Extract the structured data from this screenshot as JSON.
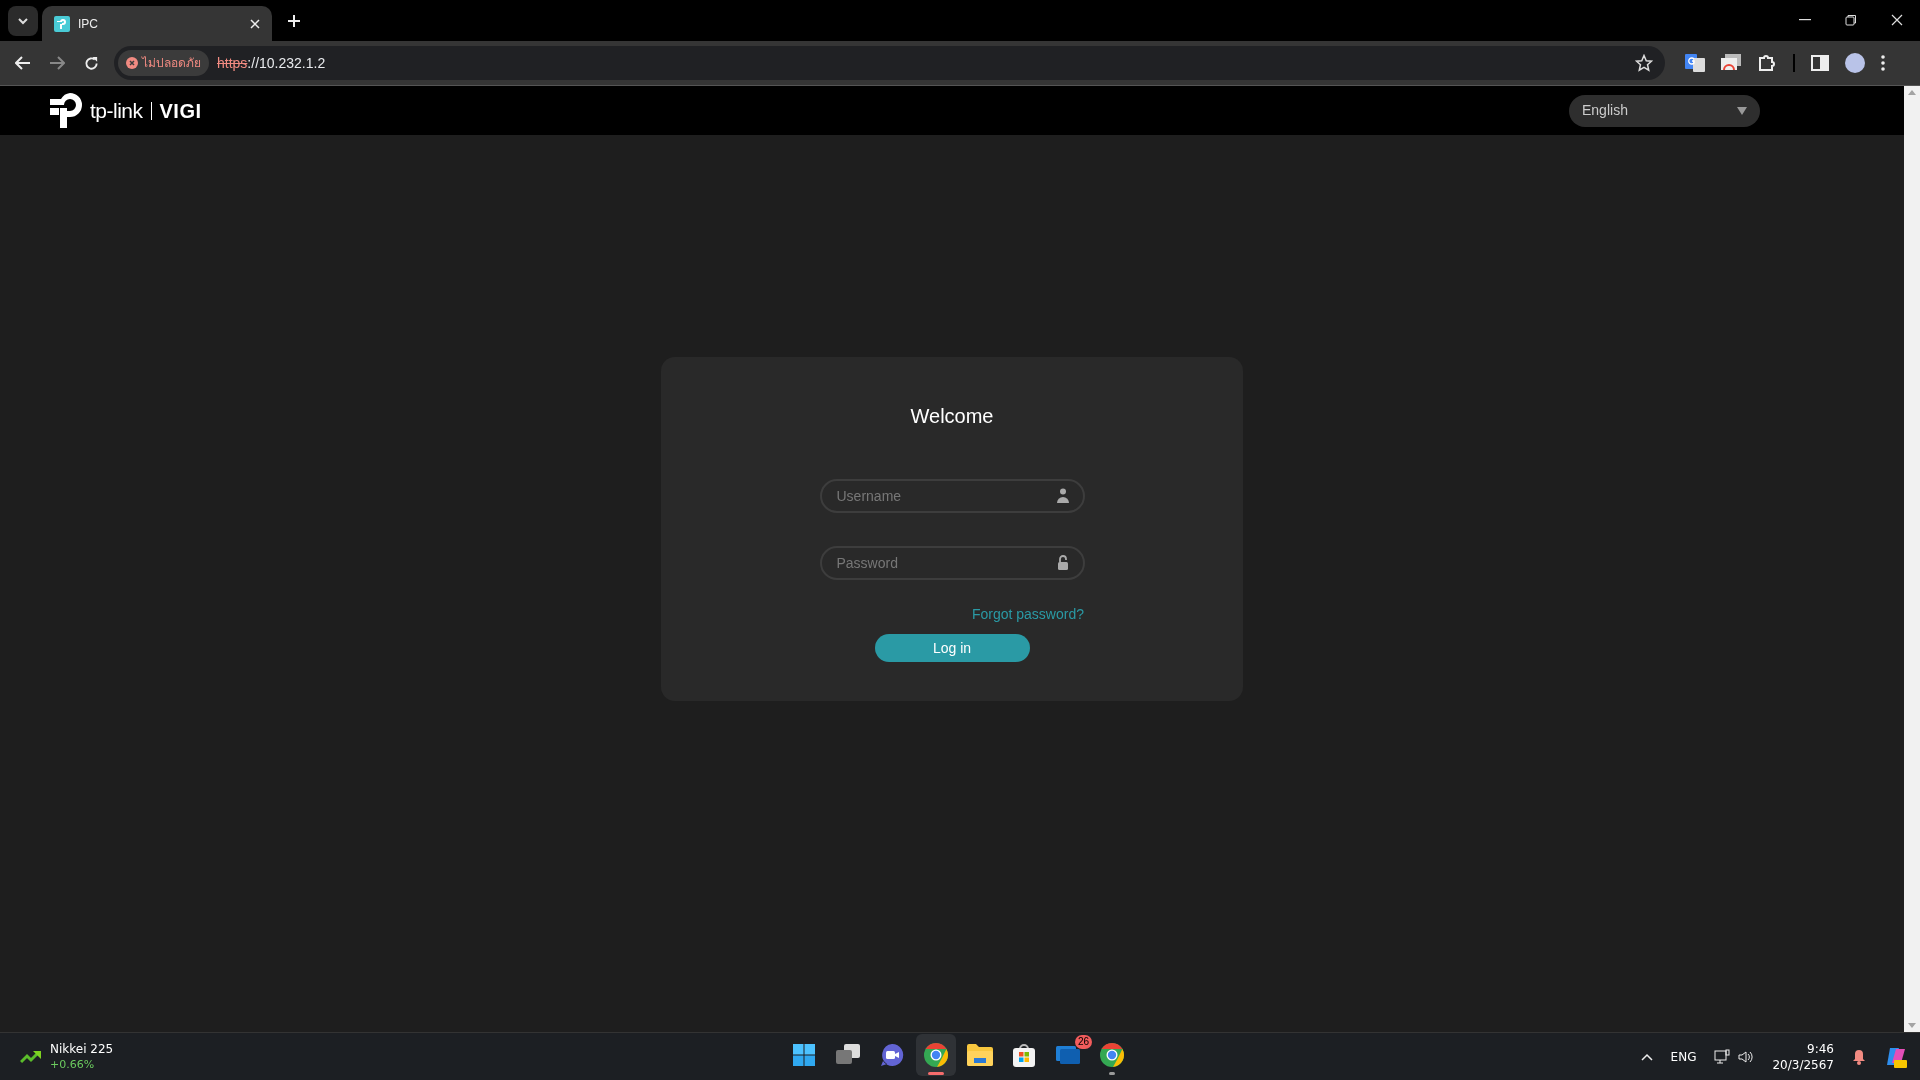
{
  "browser": {
    "tabs": [
      {
        "title": "IPC",
        "selected": true
      }
    ],
    "security_label": "ไม่ปลอดภัย",
    "url_scheme": "https",
    "url_rest": "://10.232.1.2"
  },
  "header": {
    "logo_text": "tp-link",
    "brand": "VIGI",
    "language": "English"
  },
  "login": {
    "title": "Welcome",
    "fields": [
      {
        "kind": "username",
        "placeholder": "Username"
      },
      {
        "kind": "password",
        "placeholder": "Password"
      }
    ],
    "forgot_link": "Forgot password?",
    "submit": "Log in"
  },
  "taskbar": {
    "widget": {
      "title": "Nikkei 225",
      "change": "+0.66%"
    },
    "apps": [
      {
        "kind": "start",
        "selected": false,
        "running": false
      },
      {
        "kind": "task-view",
        "selected": false,
        "running": false
      },
      {
        "kind": "meet",
        "selected": false,
        "running": false
      },
      {
        "kind": "chrome",
        "selected": true,
        "running": true
      },
      {
        "kind": "folder",
        "selected": false,
        "running": false
      },
      {
        "kind": "store",
        "selected": false,
        "running": false
      },
      {
        "kind": "mail",
        "selected": false,
        "running": false,
        "badge": "26"
      },
      {
        "kind": "chrome",
        "selected": false,
        "running": true
      }
    ],
    "language": "ENG",
    "time": "9:46",
    "date": "20/3/2567"
  }
}
